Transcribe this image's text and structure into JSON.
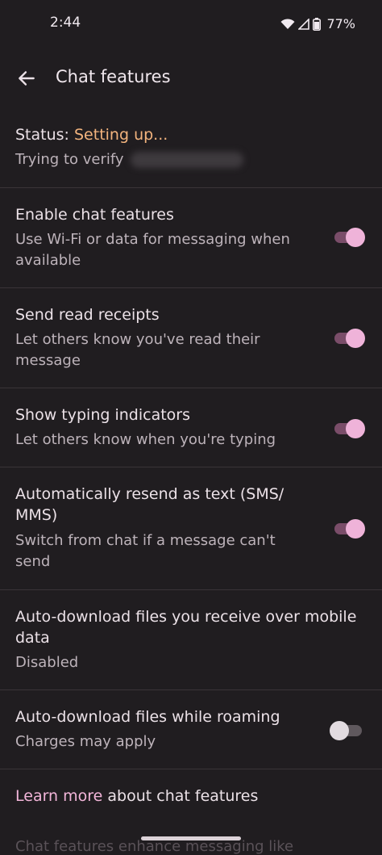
{
  "status_bar": {
    "time": "2:44",
    "battery": "77%",
    "icons": [
      "wifi-icon",
      "signal-icon",
      "battery-icon"
    ]
  },
  "app_bar": {
    "title": "Chat features",
    "back_icon": "arrow-back-icon"
  },
  "status": {
    "label": "Status:",
    "value": "Setting up...",
    "detail": "Trying to verify"
  },
  "settings": [
    {
      "title": "Enable chat features",
      "subtitle_lines": [
        "Use Wi-Fi or data for messaging when",
        "available"
      ],
      "toggle": "on"
    },
    {
      "title": "Send read receipts",
      "subtitle_lines": [
        "Let others know you've read their",
        "message"
      ],
      "toggle": "on"
    },
    {
      "title": "Show typing indicators",
      "subtitle_lines": [
        "Let others know when you're typing"
      ],
      "toggle": "on"
    },
    {
      "title_lines": [
        "Automatically resend as text (SMS/",
        "MMS)"
      ],
      "subtitle_lines": [
        "Switch from chat if a message can't",
        "send"
      ],
      "toggle": "on"
    },
    {
      "title_lines": [
        "Auto-download files you receive over mobile",
        "data"
      ],
      "subtitle_lines": [
        "Disabled"
      ]
    },
    {
      "title": "Auto-download files while roaming",
      "subtitle_lines": [
        "Charges may apply"
      ],
      "toggle": "off"
    }
  ],
  "footer": {
    "link_text": "Learn more",
    "rest_text": " about chat features",
    "faded_text": "Chat features enhance messaging like"
  },
  "colors": {
    "background": "#201d20",
    "accent_status": "#f3b47e",
    "toggle_on": "#efb3d9",
    "link": "#f2b5d9"
  }
}
